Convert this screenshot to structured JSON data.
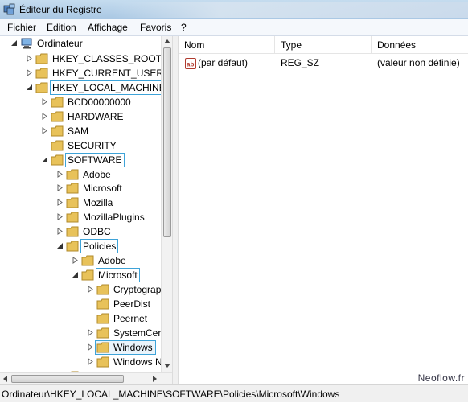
{
  "window": {
    "title": "Éditeur du Registre"
  },
  "menu": [
    "Fichier",
    "Edition",
    "Affichage",
    "Favoris",
    "?"
  ],
  "tree": {
    "root": "Ordinateur",
    "hkcr": "HKEY_CLASSES_ROOT",
    "hkcu": "HKEY_CURRENT_USER",
    "hklm": "HKEY_LOCAL_MACHINE",
    "bcd": "BCD00000000",
    "hardware": "HARDWARE",
    "sam": "SAM",
    "security": "SECURITY",
    "software": "SOFTWARE",
    "adobe": "Adobe",
    "microsoft": "Microsoft",
    "mozilla": "Mozilla",
    "mozillaplugins": "MozillaPlugins",
    "odbc": "ODBC",
    "policies": "Policies",
    "pol_adobe": "Adobe",
    "pol_microsoft": "Microsoft",
    "cryptography": "Cryptograp",
    "peerdist": "PeerDist",
    "peernet": "Peernet",
    "systemcert": "SystemCer",
    "windows": "Windows",
    "windowsn": "Windows N"
  },
  "list": {
    "columns": [
      "Nom",
      "Type",
      "Données"
    ],
    "rows": [
      {
        "name": "(par défaut)",
        "type": "REG_SZ",
        "data": "(valeur non définie)"
      }
    ]
  },
  "watermark": "Neoflow.fr",
  "status": "Ordinateur\\HKEY_LOCAL_MACHINE\\SOFTWARE\\Policies\\Microsoft\\Windows",
  "colors": {
    "selection_border": "#3ea3d8",
    "folder": "#e8c25a"
  }
}
